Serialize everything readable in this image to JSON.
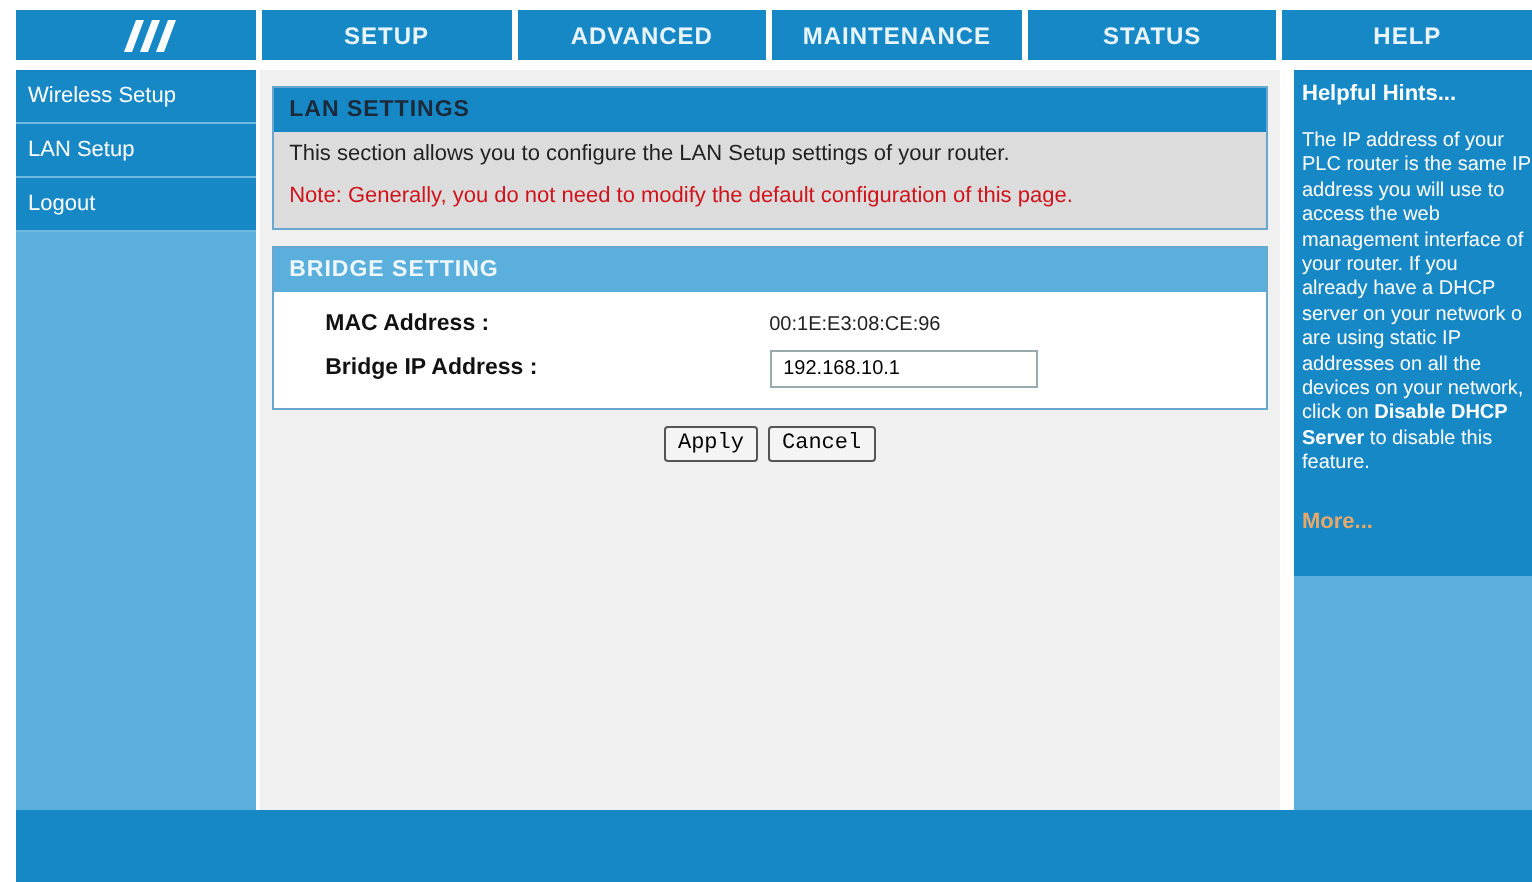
{
  "nav": {
    "tabs": [
      {
        "label": "SETUP"
      },
      {
        "label": "ADVANCED"
      },
      {
        "label": "MAINTENANCE"
      },
      {
        "label": "STATUS"
      },
      {
        "label": "HELP"
      }
    ]
  },
  "sidebar": {
    "items": [
      {
        "label": "Wireless Setup"
      },
      {
        "label": "LAN Setup"
      },
      {
        "label": "Logout"
      }
    ]
  },
  "lan_settings": {
    "title": "LAN SETTINGS",
    "description": "This section allows you to configure the LAN Setup settings of your router.",
    "note": "Note: Generally, you do not need to modify the default configuration of this page."
  },
  "bridge_setting": {
    "title": "BRIDGE SETTING",
    "mac_label": "MAC Address :",
    "mac_value": "00:1E:E3:08:CE:96",
    "ip_label": "Bridge IP Address :",
    "ip_value": "192.168.10.1"
  },
  "buttons": [
    "Apply",
    "Cancel"
  ],
  "hints": {
    "title": "Helpful Hints...",
    "text": "The IP address of your\nPLC router is the same IP\naddress you will use to\naccess the web\nmanagement interface of\nyour router. If you\nalready have a DHCP\nserver on your network o\nare using static IP\naddresses on all the\ndevices on your network,\nclick on **Disable DHCP\nServer** to disable this\nfeature.",
    "more": "More..."
  }
}
